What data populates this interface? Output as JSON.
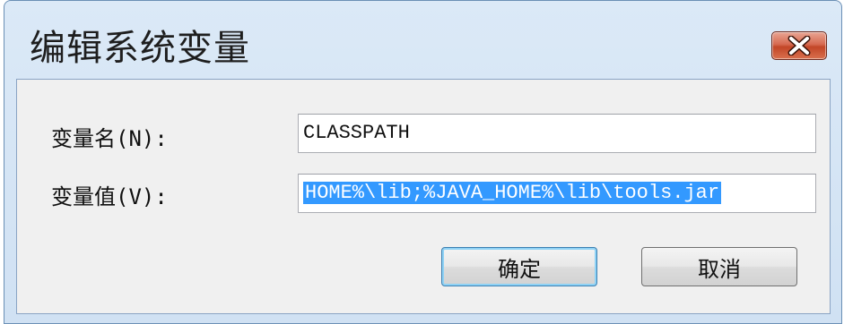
{
  "window": {
    "title": "编辑系统变量"
  },
  "fields": {
    "name_label": "变量名(N):",
    "name_value": "CLASSPATH",
    "value_label": "变量值(V):",
    "value_value": "HOME%\\lib;%JAVA_HOME%\\lib\\tools.jar"
  },
  "buttons": {
    "ok_label": "确定",
    "cancel_label": "取消"
  },
  "icons": {
    "close": "close-icon"
  },
  "colors": {
    "selection": "#3399ff",
    "close_button": "#c24627",
    "title_bar": "#dbe9f7"
  }
}
